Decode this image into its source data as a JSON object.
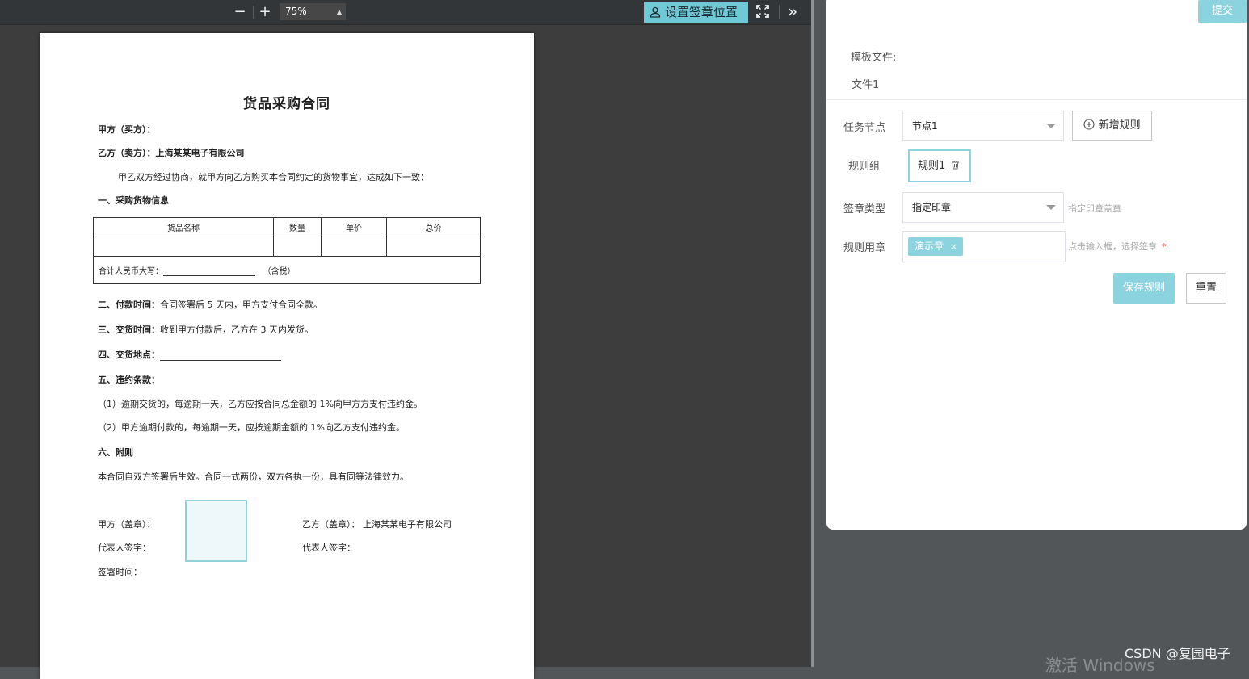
{
  "toolbar": {
    "zoom_out": "−",
    "zoom_in": "+",
    "zoom_value": "75%",
    "set_signature_label": "设置签章位置",
    "more_label": "»"
  },
  "document": {
    "title": "货品采购合同",
    "party_a": "甲方（买方）：",
    "party_b": "乙方（卖方）：上海某某电子有限公司",
    "intro": "甲乙双方经过协商，就甲方向乙方购买本合同约定的货物事宜，达成如下一致：",
    "section1": "一、采购货物信息",
    "table_headers": [
      "货品名称",
      "数量",
      "单价",
      "总价"
    ],
    "total_label": "合计人民币大写：",
    "total_suffix": "（含税）",
    "section2_title": "二、付款时间：",
    "section2_text": "合同签署后 5 天内，甲方支付合同全款。",
    "section3_title": "三、交货时间：",
    "section3_text": "收到甲方付款后，乙方在 3 天内发货。",
    "section4_title": "四、交货地点：",
    "section5_title": "五、违约条款：",
    "clause1": "（1）逾期交货的，每逾期一天，乙方应按合同总金额的 1%向甲方方支付违约金。",
    "clause2": "（2）甲方逾期付款的，每逾期一天，应按逾期金额的 1%向乙方支付违约金。",
    "section6_title": "六、附则",
    "section6_text": "本合同自双方签署后生效。合同一式两份，双方各执一份，具有同等法律效力。",
    "sign_a": "甲方（盖章）：",
    "sign_b_label": "乙方（盖章）：",
    "sign_b_company": "上海某某电子有限公司",
    "rep_a": "代表人签字：",
    "rep_b": "代表人签字：",
    "sign_time": "签署时间："
  },
  "panel": {
    "submit_label": "提交",
    "template_label": "模板文件:",
    "template_value": "文件1",
    "task_node_label": "任务节点",
    "task_node_value": "节点1",
    "add_rule_label": "新增规则",
    "rule_group_label": "规则组",
    "rule_chip": "规则1",
    "seal_type_label": "签章类型",
    "seal_type_value": "指定印章",
    "seal_type_hint": "指定印章盖章",
    "rule_seal_label": "规则用章",
    "rule_seal_tag": "演示章",
    "rule_seal_hint": "点击输入框，选择签章",
    "required_mark": "*",
    "save_label": "保存规则",
    "reset_label": "重置"
  },
  "overlay": {
    "csdn": "CSDN @复园电子",
    "windows": "激活 Windows"
  },
  "colors": {
    "accent": "#8bd3df",
    "toolbar_bg": "#323639",
    "viewer_bg": "#3d3d3d"
  }
}
